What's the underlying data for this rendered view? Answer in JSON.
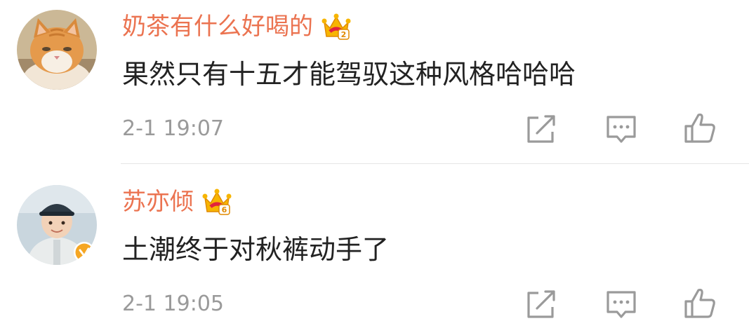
{
  "comments": [
    {
      "username": "奶茶有什么好喝的",
      "text": "果然只有十五才能驾驭这种风格哈哈哈",
      "time": "2-1 19:07",
      "avatar": "cat-avatar",
      "badge_icon": "vip-crown-icon",
      "verified": false
    },
    {
      "username": "苏亦倾",
      "text": "土潮终于对秋裤动手了",
      "time": "2-1 19:05",
      "avatar": "child-avatar",
      "badge_icon": "vip-crown-icon",
      "verified": true
    }
  ],
  "actions": [
    "share-icon",
    "comment-icon",
    "like-icon"
  ],
  "colors": {
    "username": "#eb7350",
    "text": "#222222",
    "time": "#9a9a9a",
    "icon": "#9a9a9a",
    "verified_badge": "#f5a623",
    "crown": "#f7b500",
    "divider": "#e6e6e6"
  }
}
